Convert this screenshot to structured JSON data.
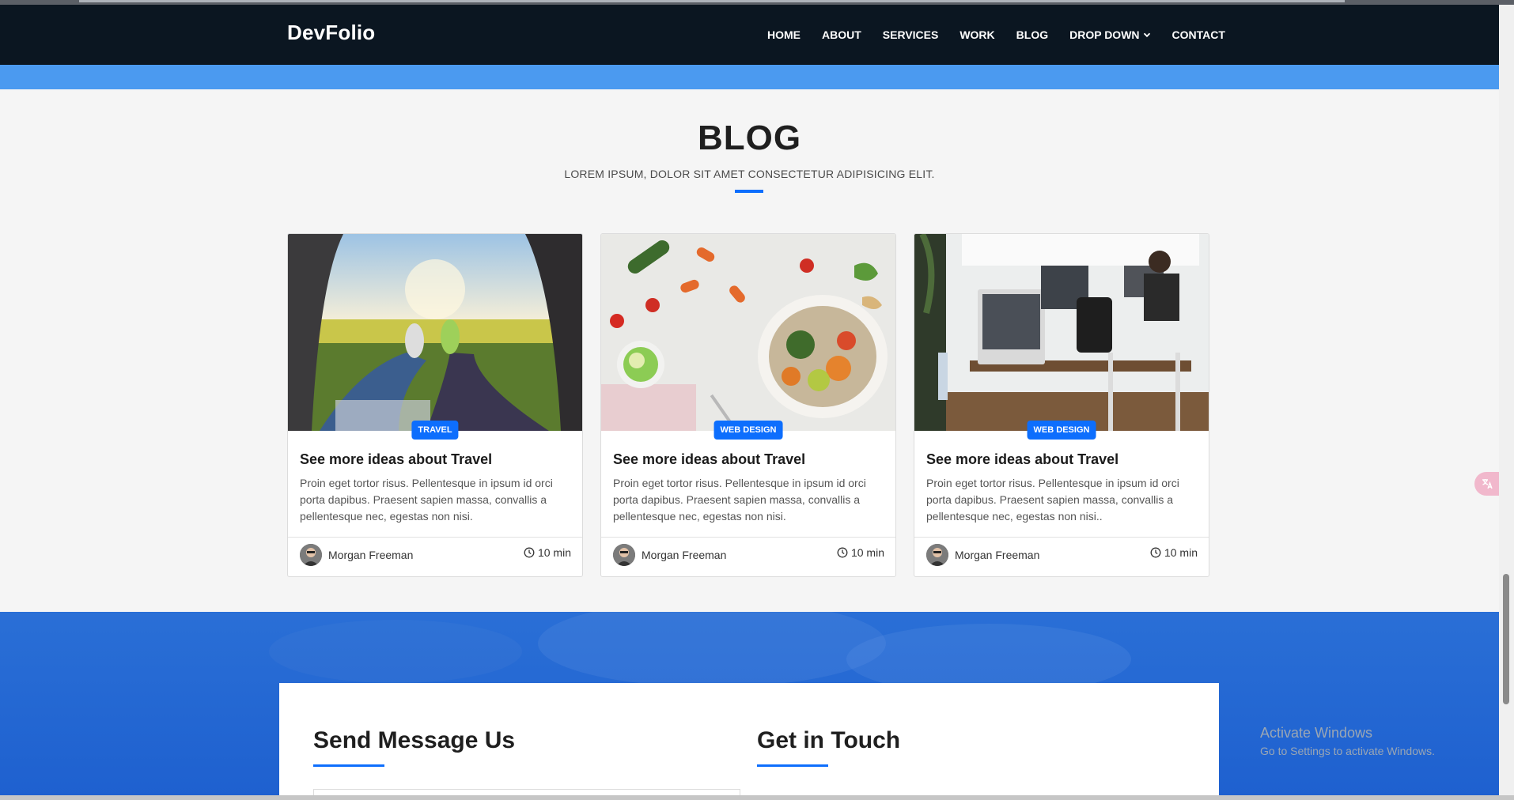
{
  "brand": "DevFolio",
  "nav": {
    "items": [
      "HOME",
      "ABOUT",
      "SERVICES",
      "WORK",
      "BLOG",
      "DROP DOWN",
      "CONTACT"
    ]
  },
  "section": {
    "title": "BLOG",
    "subtitle": "LOREM IPSUM, DOLOR SIT AMET CONSECTETUR ADIPISICING ELIT."
  },
  "cards": [
    {
      "image": "travel-photo",
      "badge": "TRAVEL",
      "title": "See more ideas about Travel",
      "text": "Proin eget tortor risus. Pellentesque in ipsum id orci porta dapibus. Praesent sapien massa, convallis a pellentesque nec, egestas non nisi.",
      "author": "Morgan Freeman",
      "time": "10 min"
    },
    {
      "image": "food-photo",
      "badge": "WEB DESIGN",
      "title": "See more ideas about Travel",
      "text": "Proin eget tortor risus. Pellentesque in ipsum id orci porta dapibus. Praesent sapien massa, convallis a pellentesque nec, egestas non nisi.",
      "author": "Morgan Freeman",
      "time": "10 min"
    },
    {
      "image": "office-photo",
      "badge": "WEB DESIGN",
      "title": "See more ideas about Travel",
      "text": "Proin eget tortor risus. Pellentesque in ipsum id orci porta dapibus. Praesent sapien massa, convallis a pellentesque nec, egestas non nisi..",
      "author": "Morgan Freeman",
      "time": "10 min"
    }
  ],
  "contact": {
    "send_title": "Send Message Us",
    "touch_title": "Get in Touch"
  },
  "watermark": {
    "line1": "Activate Windows",
    "line2": "Go to Settings to activate Windows."
  },
  "colors": {
    "navbar": "#0b1621",
    "accent": "#0d6efd",
    "band": "#4b9af0",
    "contact_bg": "#1e60cf"
  },
  "icons": {
    "dropdown": "chevron-down-icon",
    "time": "clock-icon",
    "translate": "translate-icon"
  }
}
